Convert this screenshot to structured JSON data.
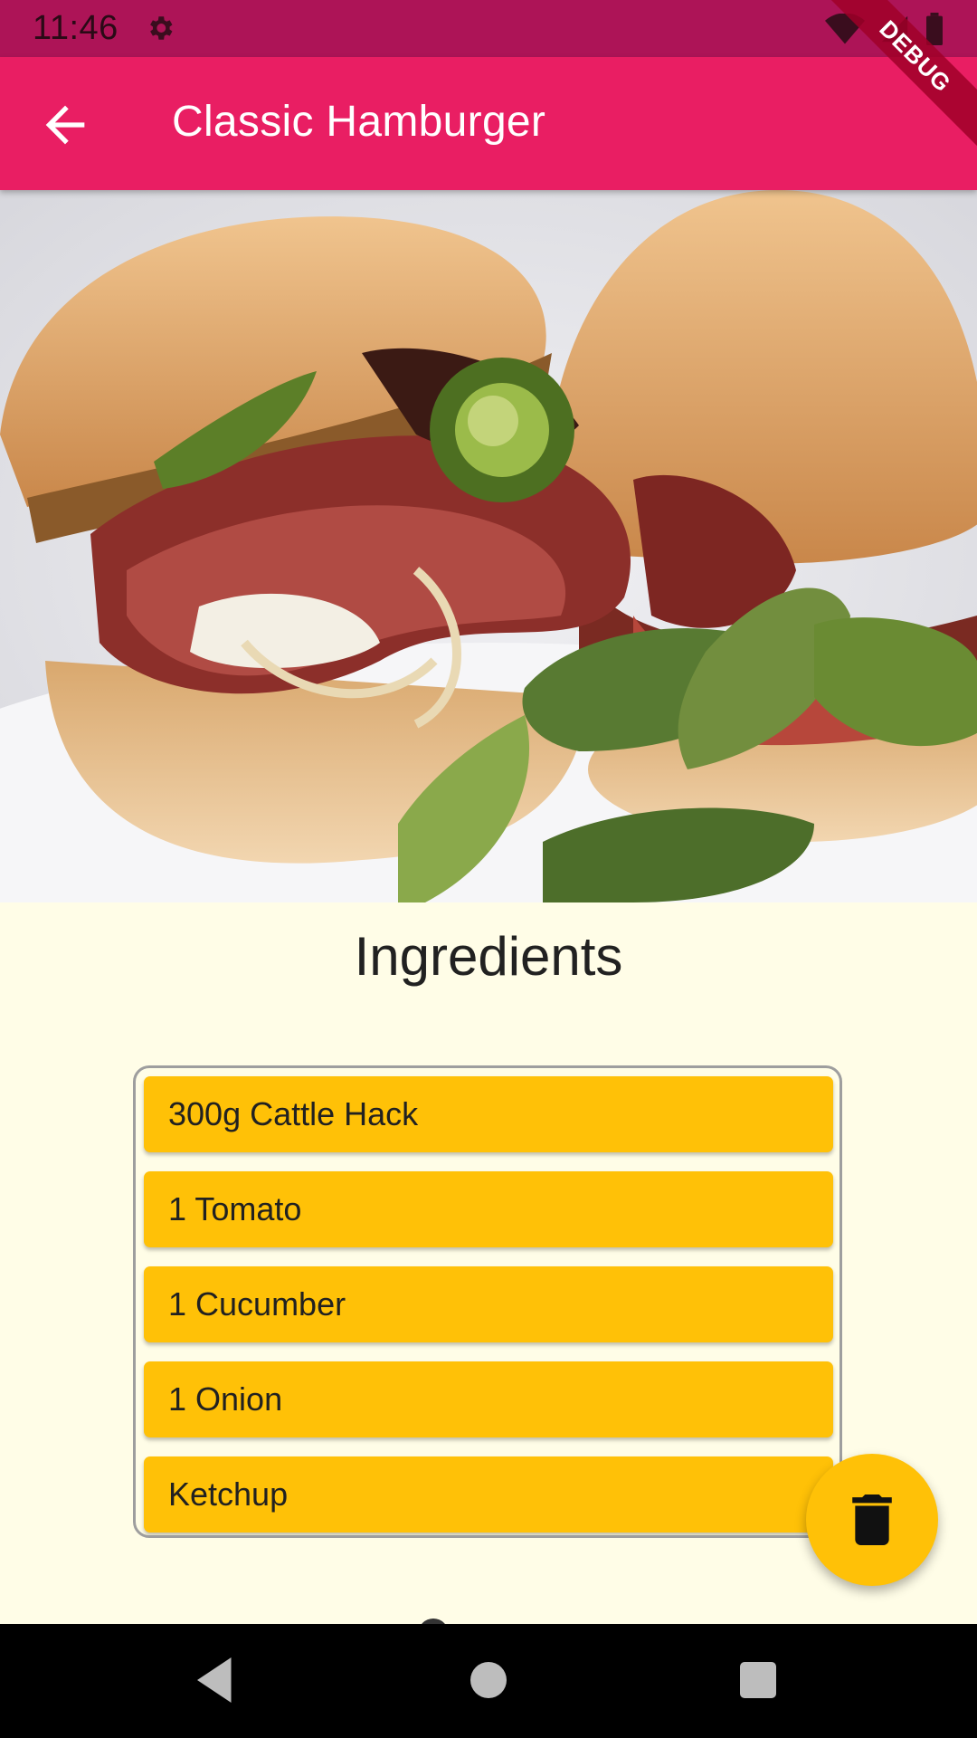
{
  "status_bar": {
    "time": "11:46",
    "icons": [
      "settings-icon",
      "wifi-icon",
      "signal-icon",
      "battery-icon"
    ]
  },
  "app_bar": {
    "title": "Classic Hamburger",
    "back_icon": "arrow-back-icon",
    "debug_banner": "DEBUG"
  },
  "hero_image": {
    "subject": "burger-photo"
  },
  "ingredients": {
    "title": "Ingredients",
    "items": [
      "300g Cattle Hack",
      "1 Tomato",
      "1 Cucumber",
      "1 Onion",
      "Ketchup"
    ]
  },
  "fab": {
    "icon": "delete-icon"
  },
  "nav_bar": {
    "icons": [
      "back-triangle-icon",
      "home-circle-icon",
      "recents-square-icon"
    ]
  },
  "colors": {
    "status_bar": "#ad1457",
    "app_bar": "#e91e63",
    "background": "#fffde7",
    "accent": "#ffc107"
  }
}
